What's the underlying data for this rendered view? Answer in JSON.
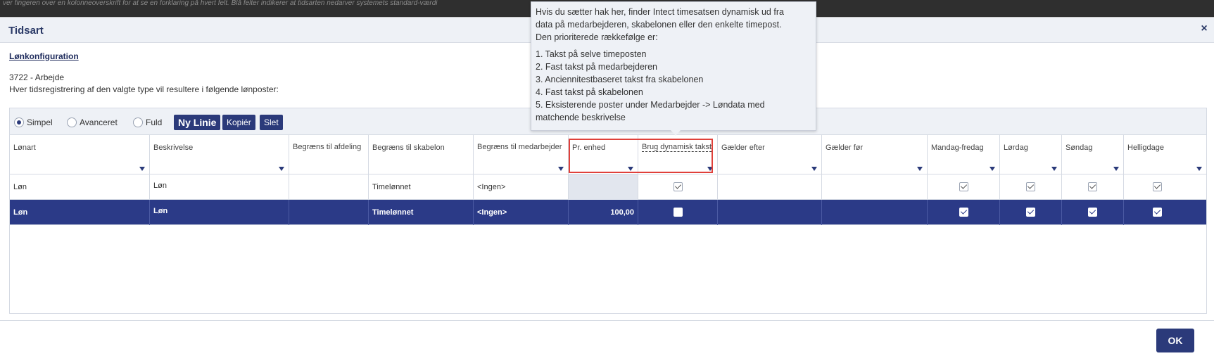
{
  "background_hint": "ver fingeren over en kolonneoverskrift for at se en forklaring på hvert felt. Blå felter indikerer at tidsarten nedarver systemets standard-værdi",
  "dialog": {
    "title": "Tidsart",
    "close_icon": "×"
  },
  "config": {
    "heading": "Lønkonfiguration",
    "code": "3722 - Arbejde",
    "description": "Hver tidsregistrering af den valgte type vil resultere i følgende lønposter:"
  },
  "toolbar": {
    "radio_simple": "Simpel",
    "radio_advanced": "Avanceret",
    "radio_full": "Fuld",
    "selected_mode": "Simpel",
    "btn_new": "Ny Linie",
    "btn_copy": "Kopiér",
    "btn_delete": "Slet"
  },
  "columns": {
    "lonart": "Lønart",
    "beskrivelse": "Beskrivelse",
    "afdeling": "Begræns til afdeling",
    "skabelon": "Begræns til skabelon",
    "medarbejder": "Begræns til medarbejder",
    "pr_enhed": "Pr. enhed",
    "dynamisk": "Brug dynamisk takst",
    "gaelder_efter": "Gælder efter",
    "gaelder_for": "Gælder før",
    "mandag_fredag": "Mandag-fredag",
    "lordag": "Lørdag",
    "sondag": "Søndag",
    "helligdage": "Helligdage"
  },
  "rows": [
    {
      "lonart": "Løn",
      "beskrivelse": "Løn",
      "afdeling": "",
      "skabelon": "Timelønnet",
      "medarbejder": "<Ingen>",
      "pr_enhed": "",
      "dynamisk": true,
      "gaelder_efter": "",
      "gaelder_for": "",
      "mandag_fredag": true,
      "lordag": true,
      "sondag": true,
      "helligdage": true
    },
    {
      "lonart": "Løn",
      "beskrivelse": "Løn",
      "afdeling": "",
      "skabelon": "Timelønnet",
      "medarbejder": "<Ingen>",
      "pr_enhed": "100,00",
      "dynamisk": false,
      "gaelder_efter": "",
      "gaelder_for": "",
      "mandag_fredag": true,
      "lordag": true,
      "sondag": true,
      "helligdage": true
    }
  ],
  "tooltip": {
    "line1": "Hvis du sætter hak her, finder Intect timesatsen dynamisk ud fra",
    "line2": "data på medarbejderen, skabelonen eller den enkelte timepost.",
    "line3": "Den prioriterede rækkefølge er:",
    "items": [
      "1. Takst på selve timeposten",
      "2. Fast takst på medarbejderen",
      "3. Anciennitestbaseret takst fra skabelonen",
      "4. Fast takst på skabelonen",
      "5. Eksisterende poster under Medarbejder -> Løndata med",
      "matchende beskrivelse"
    ]
  },
  "footer": {
    "ok": "OK"
  },
  "colors": {
    "primary": "#2b3a7a",
    "selected_row": "#2b3a87",
    "highlight": "#e0403a"
  }
}
